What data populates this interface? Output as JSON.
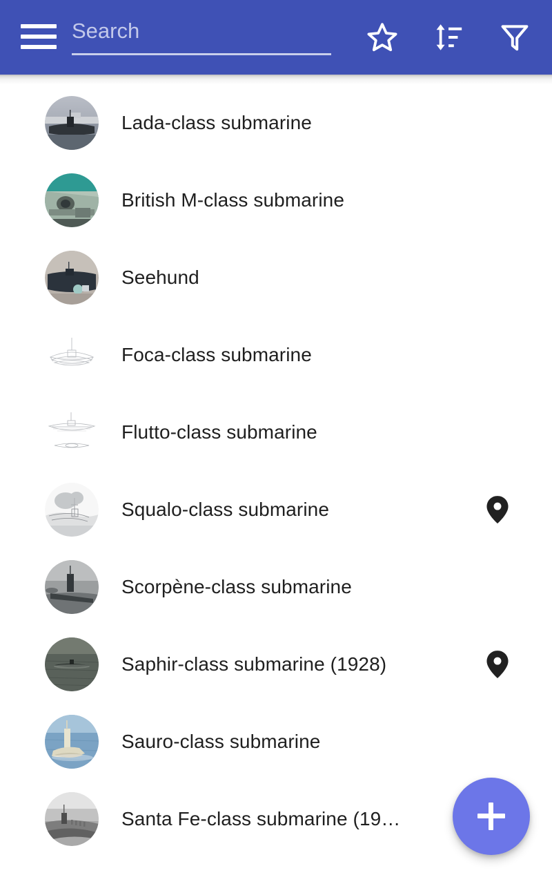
{
  "appbar": {
    "background_color": "#3f51b5",
    "menu_icon": "hamburger-menu-icon",
    "search": {
      "placeholder": "Search",
      "value": ""
    },
    "actions": [
      {
        "name": "favorites-button",
        "icon": "star-outline-icon",
        "label": "Favorites"
      },
      {
        "name": "sort-button",
        "icon": "sort-icon",
        "label": "Sort"
      },
      {
        "name": "filter-button",
        "icon": "filter-funnel-icon",
        "label": "Filter"
      }
    ]
  },
  "list": {
    "items": [
      {
        "label": "Lada-class submarine",
        "thumb": "photo-sub-harbour-grey",
        "has_location_pin": false
      },
      {
        "label": "British M-class submarine",
        "thumb": "photo-sub-teal-deck",
        "has_location_pin": false
      },
      {
        "label": "Seehund",
        "thumb": "photo-midget-sub-dark",
        "has_location_pin": false
      },
      {
        "label": "Foca-class submarine",
        "thumb": "line-drawing-sub-pale",
        "has_location_pin": false
      },
      {
        "label": "Flutto-class submarine",
        "thumb": "line-drawing-sub-profile",
        "has_location_pin": false
      },
      {
        "label": "Squalo-class submarine",
        "thumb": "photo-sub-bw-faded",
        "has_location_pin": true
      },
      {
        "label": "Scorpène-class submarine",
        "thumb": "photo-sub-grey-conning",
        "has_location_pin": false
      },
      {
        "label": "Saphir-class submarine (1928)",
        "thumb": "photo-sub-dark-sea",
        "has_location_pin": true
      },
      {
        "label": "Sauro-class submarine",
        "thumb": "photo-sub-blue-sea",
        "has_location_pin": false
      },
      {
        "label": "Santa Fe-class submarine (19…",
        "thumb": "photo-sub-bw-crew",
        "has_location_pin": false
      }
    ]
  },
  "fab": {
    "label": "Add",
    "icon": "plus-icon",
    "color": "#6c76e8"
  },
  "colors": {
    "accent": "#3f51b5",
    "fab": "#6c76e8",
    "text_primary": "#1f1f1f",
    "placeholder": "#c3c9ea",
    "pin": "#212121"
  }
}
